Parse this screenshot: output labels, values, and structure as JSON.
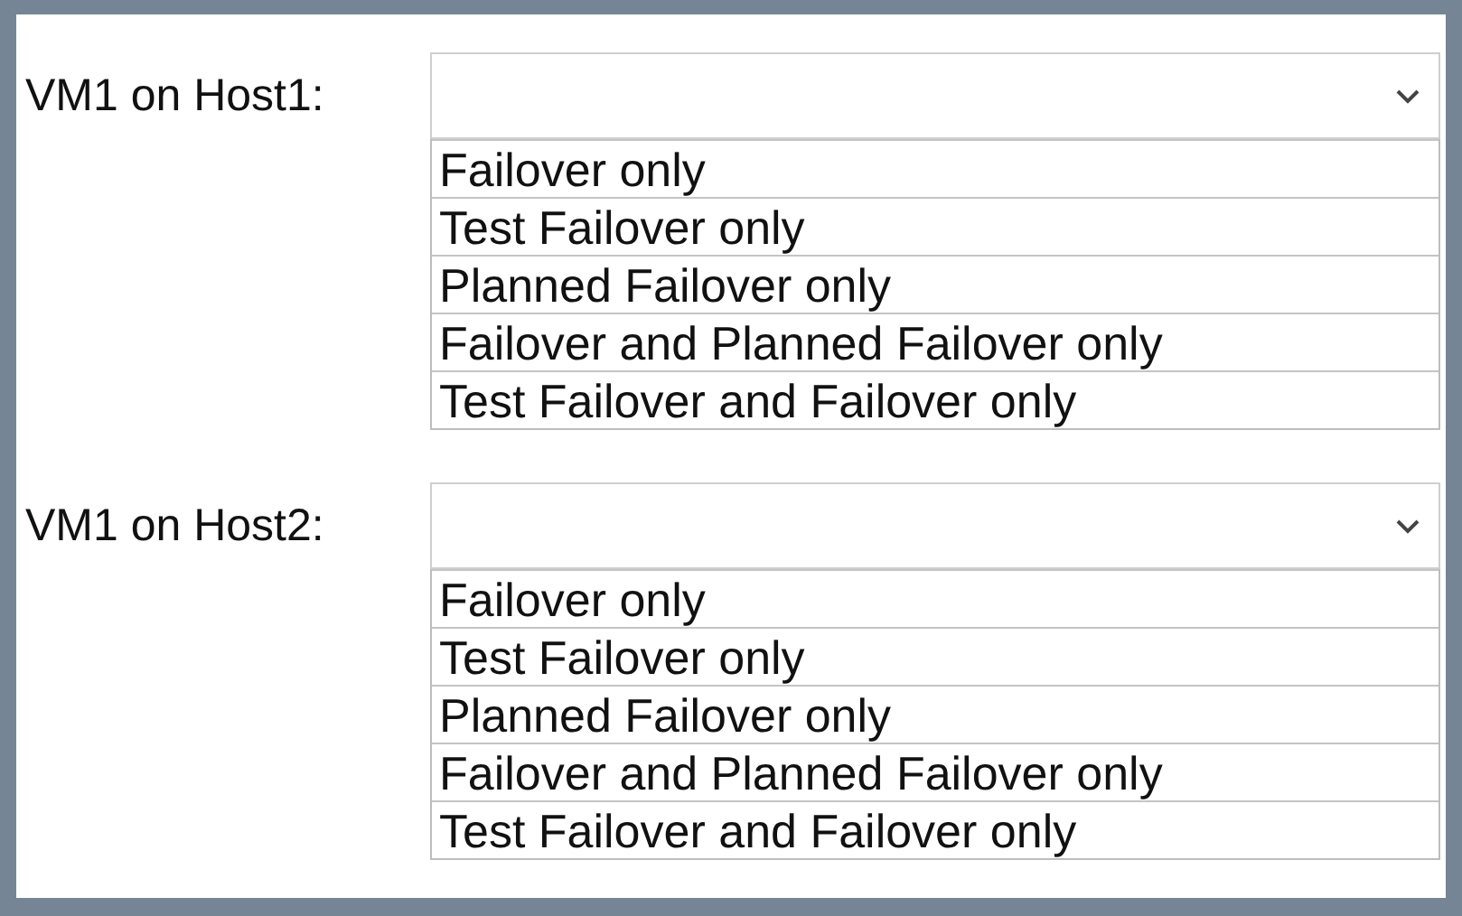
{
  "dropdowns": [
    {
      "label": "VM1 on Host1:",
      "options": [
        "Failover only",
        "Test Failover only",
        "Planned Failover only",
        "Failover and Planned Failover only",
        "Test Failover and Failover only"
      ]
    },
    {
      "label": "VM1 on Host2:",
      "options": [
        "Failover only",
        "Test Failover only",
        "Planned Failover only",
        "Failover and Planned Failover only",
        "Test Failover and Failover only"
      ]
    }
  ]
}
